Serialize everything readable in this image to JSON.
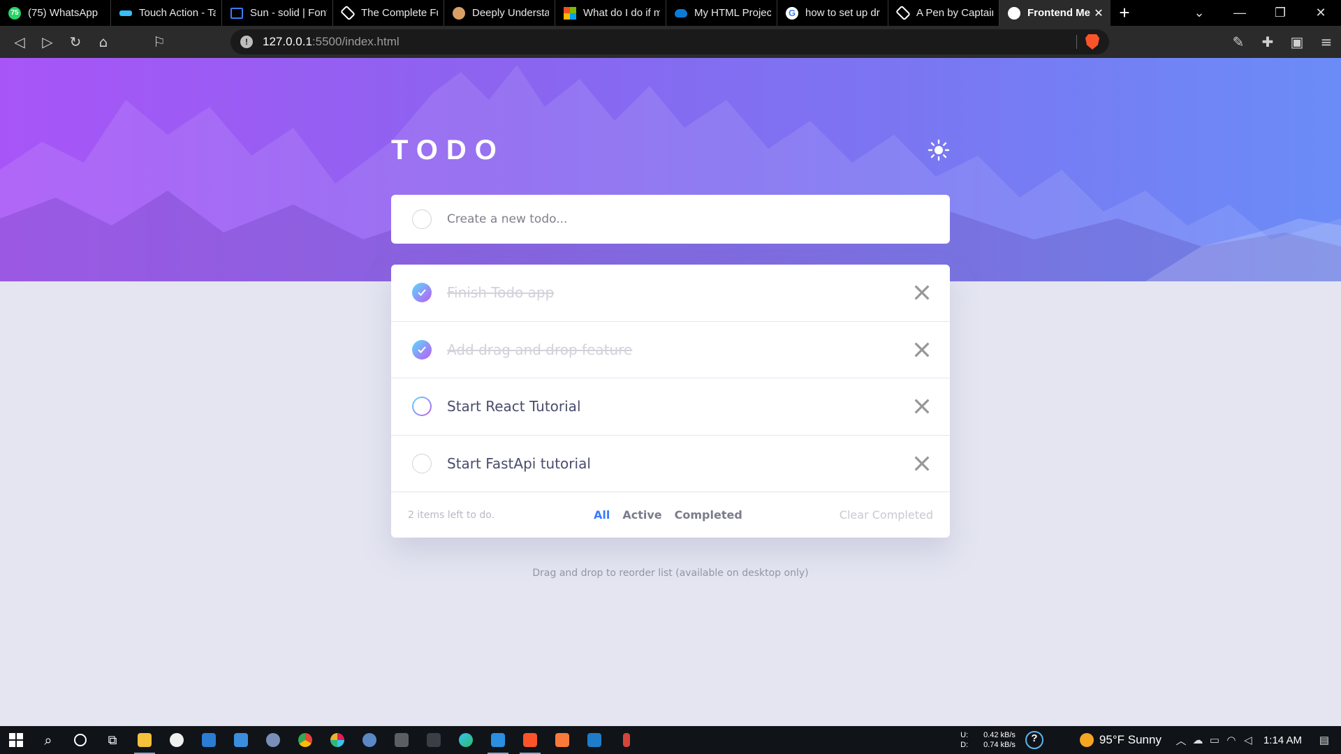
{
  "browser": {
    "tabs": [
      {
        "label": "(75) WhatsApp",
        "icon": "whatsapp-icon",
        "color": "#25d366",
        "badge": "75"
      },
      {
        "label": "Touch Action - Ta",
        "icon": "tailwind-icon",
        "color": "#38bdf8"
      },
      {
        "label": "Sun - solid | Font",
        "icon": "flag-icon",
        "color": "#3a7bfd"
      },
      {
        "label": "The Complete Fu",
        "icon": "codepen-icon",
        "color": "#ffffff"
      },
      {
        "label": "Deeply Understa",
        "icon": "monkey-icon",
        "color": "#d9a066"
      },
      {
        "label": "What do I do if m",
        "icon": "microsoft-icon",
        "color": "#f25022"
      },
      {
        "label": "My HTML Projec",
        "icon": "onedrive-icon",
        "color": "#0a7cd7"
      },
      {
        "label": "how to set up dr",
        "icon": "google-icon",
        "color": "#4285f4"
      },
      {
        "label": "A Pen by Captain",
        "icon": "codepen-icon",
        "color": "#ffffff"
      },
      {
        "label": "Frontend Me",
        "icon": "frontend-mentor-icon",
        "color": "#ffffff",
        "active": true
      }
    ],
    "new_tab": "+",
    "url_host": "127.0.0.1",
    "url_path": ":5500/index.html"
  },
  "app": {
    "title": "TODO",
    "new_todo_placeholder": "Create a new todo...",
    "todos": [
      {
        "text": "Finish Todo app",
        "completed": true
      },
      {
        "text": "Add drag and drop feature",
        "completed": true
      },
      {
        "text": "Start React Tutorial",
        "completed": false,
        "hovered": true
      },
      {
        "text": "Start FastApi tutorial",
        "completed": false
      }
    ],
    "items_left": "2 items left to do.",
    "filters": [
      {
        "label": "All",
        "active": true
      },
      {
        "label": "Active",
        "active": false
      },
      {
        "label": "Completed",
        "active": false
      }
    ],
    "clear_completed": "Clear Completed",
    "hint": "Drag and drop to reorder list (available on desktop only)",
    "colors": {
      "accent": "#3a7bfd",
      "check_gradient_start": "#55ddff",
      "check_gradient_end": "#c058f3",
      "page_bg": "#e4e5f1"
    }
  },
  "taskbar": {
    "net_up_label": "U:",
    "net_down_label": "D:",
    "net_up": "0.42 kB/s",
    "net_down": "0.74 kB/s",
    "weather": "95°F  Sunny",
    "time": "1:14 AM"
  }
}
